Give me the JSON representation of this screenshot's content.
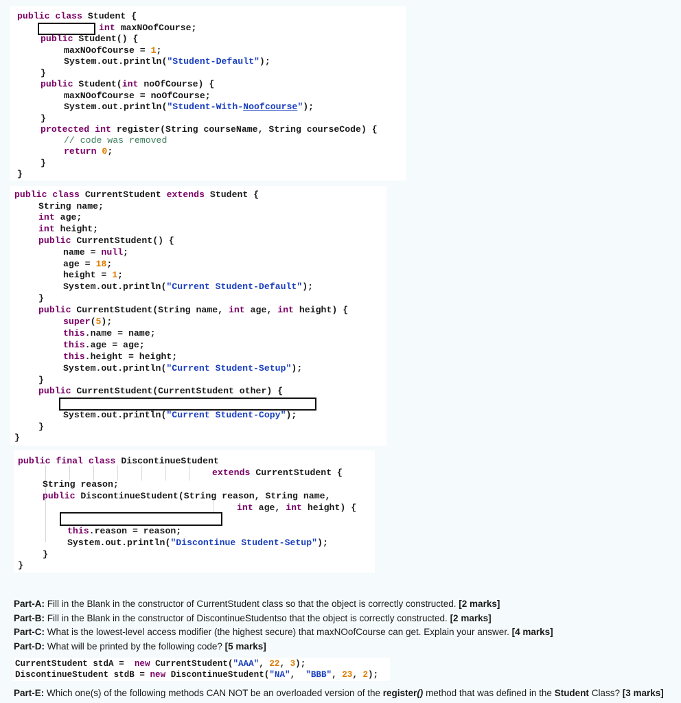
{
  "code_student": [
    [
      {
        "t": "public class",
        "c": "kw"
      },
      {
        "t": " Student {"
      }
    ],
    [
      {
        "t": "int",
        "c": "kw"
      },
      {
        "t": " maxNOofCourse;"
      }
    ],
    [
      {
        "t": "public",
        "c": "kw"
      },
      {
        "t": " Student() {"
      }
    ],
    [
      {
        "t": "maxNOofCourse = "
      },
      {
        "t": "1",
        "c": "num"
      },
      {
        "t": ";"
      }
    ],
    [
      {
        "t": "System.out.println("
      },
      {
        "t": "\"Student-Default\"",
        "c": "str"
      },
      {
        "t": ");"
      }
    ],
    [
      {
        "t": "}"
      }
    ],
    [
      {
        "t": "public",
        "c": "kw"
      },
      {
        "t": " Student("
      },
      {
        "t": "int",
        "c": "kw"
      },
      {
        "t": " noOfCourse) {"
      }
    ],
    [
      {
        "t": "maxNOofCourse = noOfCourse;"
      }
    ],
    [
      {
        "t": "System.out.println("
      },
      {
        "t": "\"Student-With-",
        "c": "str"
      },
      {
        "t": "Noofcourse",
        "c": "str und"
      },
      {
        "t": "\"",
        "c": "str"
      },
      {
        "t": ");"
      }
    ],
    [
      {
        "t": "}"
      }
    ],
    [
      {
        "t": "protected",
        "c": "kw"
      },
      {
        "t": " "
      },
      {
        "t": "int",
        "c": "kw"
      },
      {
        "t": " register(String courseName, String courseCode) {"
      }
    ],
    [
      {
        "t": "// code was removed",
        "c": "cmt"
      }
    ],
    [
      {
        "t": "return",
        "c": "kw"
      },
      {
        "t": " "
      },
      {
        "t": "0",
        "c": "num"
      },
      {
        "t": ";"
      }
    ],
    [
      {
        "t": "}"
      }
    ],
    [
      {
        "t": "}"
      }
    ]
  ],
  "code_current": [
    [
      {
        "t": "public class",
        "c": "kw"
      },
      {
        "t": " CurrentStudent "
      },
      {
        "t": "extends",
        "c": "kw"
      },
      {
        "t": " Student {"
      }
    ],
    [
      {
        "t": "String name;"
      }
    ],
    [
      {
        "t": "int",
        "c": "kw"
      },
      {
        "t": " age;"
      }
    ],
    [
      {
        "t": "int",
        "c": "kw"
      },
      {
        "t": " height;"
      }
    ],
    [
      {
        "t": "public",
        "c": "kw"
      },
      {
        "t": " CurrentStudent() {"
      }
    ],
    [
      {
        "t": "name = "
      },
      {
        "t": "null",
        "c": "kw"
      },
      {
        "t": ";"
      }
    ],
    [
      {
        "t": "age = "
      },
      {
        "t": "18",
        "c": "num"
      },
      {
        "t": ";"
      }
    ],
    [
      {
        "t": "height = "
      },
      {
        "t": "1",
        "c": "num"
      },
      {
        "t": ";"
      }
    ],
    [
      {
        "t": "System.out.println("
      },
      {
        "t": "\"Current Student-Default\"",
        "c": "str"
      },
      {
        "t": ");"
      }
    ],
    [
      {
        "t": "}"
      }
    ],
    [
      {
        "t": "public",
        "c": "kw"
      },
      {
        "t": " CurrentStudent(String name, "
      },
      {
        "t": "int",
        "c": "kw"
      },
      {
        "t": " age, "
      },
      {
        "t": "int",
        "c": "kw"
      },
      {
        "t": " height) {"
      }
    ],
    [
      {
        "t": "super",
        "c": "kw"
      },
      {
        "t": "("
      },
      {
        "t": "5",
        "c": "num"
      },
      {
        "t": ");"
      }
    ],
    [
      {
        "t": "this",
        "c": "kw"
      },
      {
        "t": ".name = name;"
      }
    ],
    [
      {
        "t": "this",
        "c": "kw"
      },
      {
        "t": ".age = age;"
      }
    ],
    [
      {
        "t": "this",
        "c": "kw"
      },
      {
        "t": ".height = height;"
      }
    ],
    [
      {
        "t": "System.out.println("
      },
      {
        "t": "\"Current Student-Setup\"",
        "c": "str"
      },
      {
        "t": ");"
      }
    ],
    [
      {
        "t": "}"
      }
    ],
    [
      {
        "t": "public",
        "c": "kw"
      },
      {
        "t": " CurrentStudent(CurrentStudent other) {"
      }
    ],
    [
      {
        "t": "System.out.println("
      },
      {
        "t": "\"Current Student-Copy\"",
        "c": "str"
      },
      {
        "t": ");"
      }
    ],
    [
      {
        "t": "}"
      }
    ],
    [
      {
        "t": "}"
      }
    ]
  ],
  "code_discontinue": [
    [
      {
        "t": "public final class",
        "c": "kw"
      },
      {
        "t": " DiscontinueStudent"
      }
    ],
    [
      {
        "t": "extends",
        "c": "kw"
      },
      {
        "t": " CurrentStudent {"
      }
    ],
    [
      {
        "t": "String reason;"
      }
    ],
    [
      {
        "t": "public",
        "c": "kw"
      },
      {
        "t": " DiscontinueStudent(String reason, String name,"
      }
    ],
    [
      {
        "t": "int",
        "c": "kw"
      },
      {
        "t": " age, "
      },
      {
        "t": "int",
        "c": "kw"
      },
      {
        "t": " height) {"
      }
    ],
    [
      {
        "t": "this",
        "c": "kw"
      },
      {
        "t": ".reason = reason;"
      }
    ],
    [
      {
        "t": "System.out.println("
      },
      {
        "t": "\"Discontinue Student-Setup\"",
        "c": "str"
      },
      {
        "t": ");"
      }
    ],
    [
      {
        "t": "}"
      }
    ],
    [
      {
        "t": "}"
      }
    ]
  ],
  "questions": {
    "a": {
      "label": "Part-A:",
      "text": " Fill in the Blank in the constructor of CurrentStudent class so that the object is correctly constructed. ",
      "marks": "[2 marks]"
    },
    "b": {
      "label": "Part-B:",
      "text": " Fill in the Blank in the constructor of DiscontinueStudentso that the object is correctly constructed. ",
      "marks": "[2 marks]"
    },
    "c": {
      "label": "Part-C:",
      "text": " What is the lowest-level access modifier (the highest secure) that maxNOofCourse can get.  Explain your answer. ",
      "marks": "[4 marks]"
    },
    "d": {
      "label": "Part-D:",
      "text": " What will be printed by the following code? ",
      "marks": "[5 marks]"
    },
    "e": {
      "label": "Part-E:",
      "text_1": " Which one(s) of the following methods CAN NOT be an overloaded version of the ",
      "method": "register()",
      "text_2": " method that was defined in the ",
      "cls": "Student",
      "text_3": " Class? ",
      "marks": "[3 marks]"
    }
  },
  "code_partd": [
    [
      {
        "t": "CurrentStudent stdA =  "
      },
      {
        "t": "new",
        "c": "kw"
      },
      {
        "t": " CurrentStudent("
      },
      {
        "t": "\"AAA\"",
        "c": "str"
      },
      {
        "t": ", "
      },
      {
        "t": "22",
        "c": "num"
      },
      {
        "t": ", "
      },
      {
        "t": "3",
        "c": "num"
      },
      {
        "t": ");"
      }
    ],
    [
      {
        "t": "DiscontinueStudent stdB = "
      },
      {
        "t": "new",
        "c": "kw"
      },
      {
        "t": " DiscontinueStudent("
      },
      {
        "t": "\"NA\"",
        "c": "str"
      },
      {
        "t": ",  "
      },
      {
        "t": "\"BBB\"",
        "c": "str"
      },
      {
        "t": ", "
      },
      {
        "t": "23",
        "c": "num"
      },
      {
        "t": ", "
      },
      {
        "t": "2",
        "c": "num"
      },
      {
        "t": ");"
      }
    ]
  ]
}
